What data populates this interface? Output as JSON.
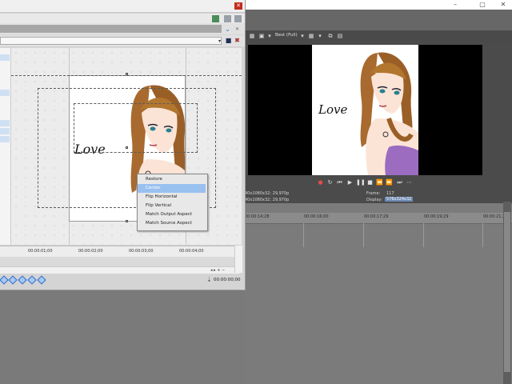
{
  "app": {
    "window_buttons": [
      "–",
      "▢",
      "✕"
    ],
    "preview": {
      "quality_label": "Best (Full)",
      "project_line1": "40x1080x32; 29,970p",
      "project_line2": "40x1080x32; 29,970p",
      "frame_label": "Frame:",
      "frame_value": "117",
      "display_label": "Display:",
      "display_value": "576x324x32",
      "artwork_text": "Love"
    },
    "transport_icons": [
      "record-icon",
      "loop-icon",
      "play-from-start-icon",
      "play-icon",
      "pause-icon",
      "stop-icon",
      "prev-frame-icon",
      "next-frame-icon",
      "jump-end-icon",
      "more-icon"
    ],
    "timeline_ticks": [
      "00:00:14;28",
      "00:00:16;00",
      "00:00:17;29",
      "00:00:19;29",
      "00:00:21;29"
    ]
  },
  "dialog": {
    "close_symbol": "✕",
    "artwork_text": "Love",
    "ruler_ticks": [
      "00:00:01;00",
      "00:00:02;00",
      "00:00:03;00",
      "00:00:04;00"
    ],
    "timecode": "00:00:00;00",
    "context_menu": [
      {
        "label": "Restore",
        "highlighted": false
      },
      {
        "label": "Center",
        "highlighted": true
      },
      {
        "label": "Flip Horizontal",
        "highlighted": false
      },
      {
        "label": "Flip Vertical",
        "highlighted": false
      },
      {
        "label": "Match Output Aspect",
        "highlighted": false
      },
      {
        "label": "Match Source Aspect",
        "highlighted": false
      }
    ]
  },
  "colors": {
    "app_background": "#4b4b4b",
    "menu_highlight": "#99c1f0",
    "close_red": "#c42b1c",
    "display_value_bg": "#6d8bb5"
  }
}
